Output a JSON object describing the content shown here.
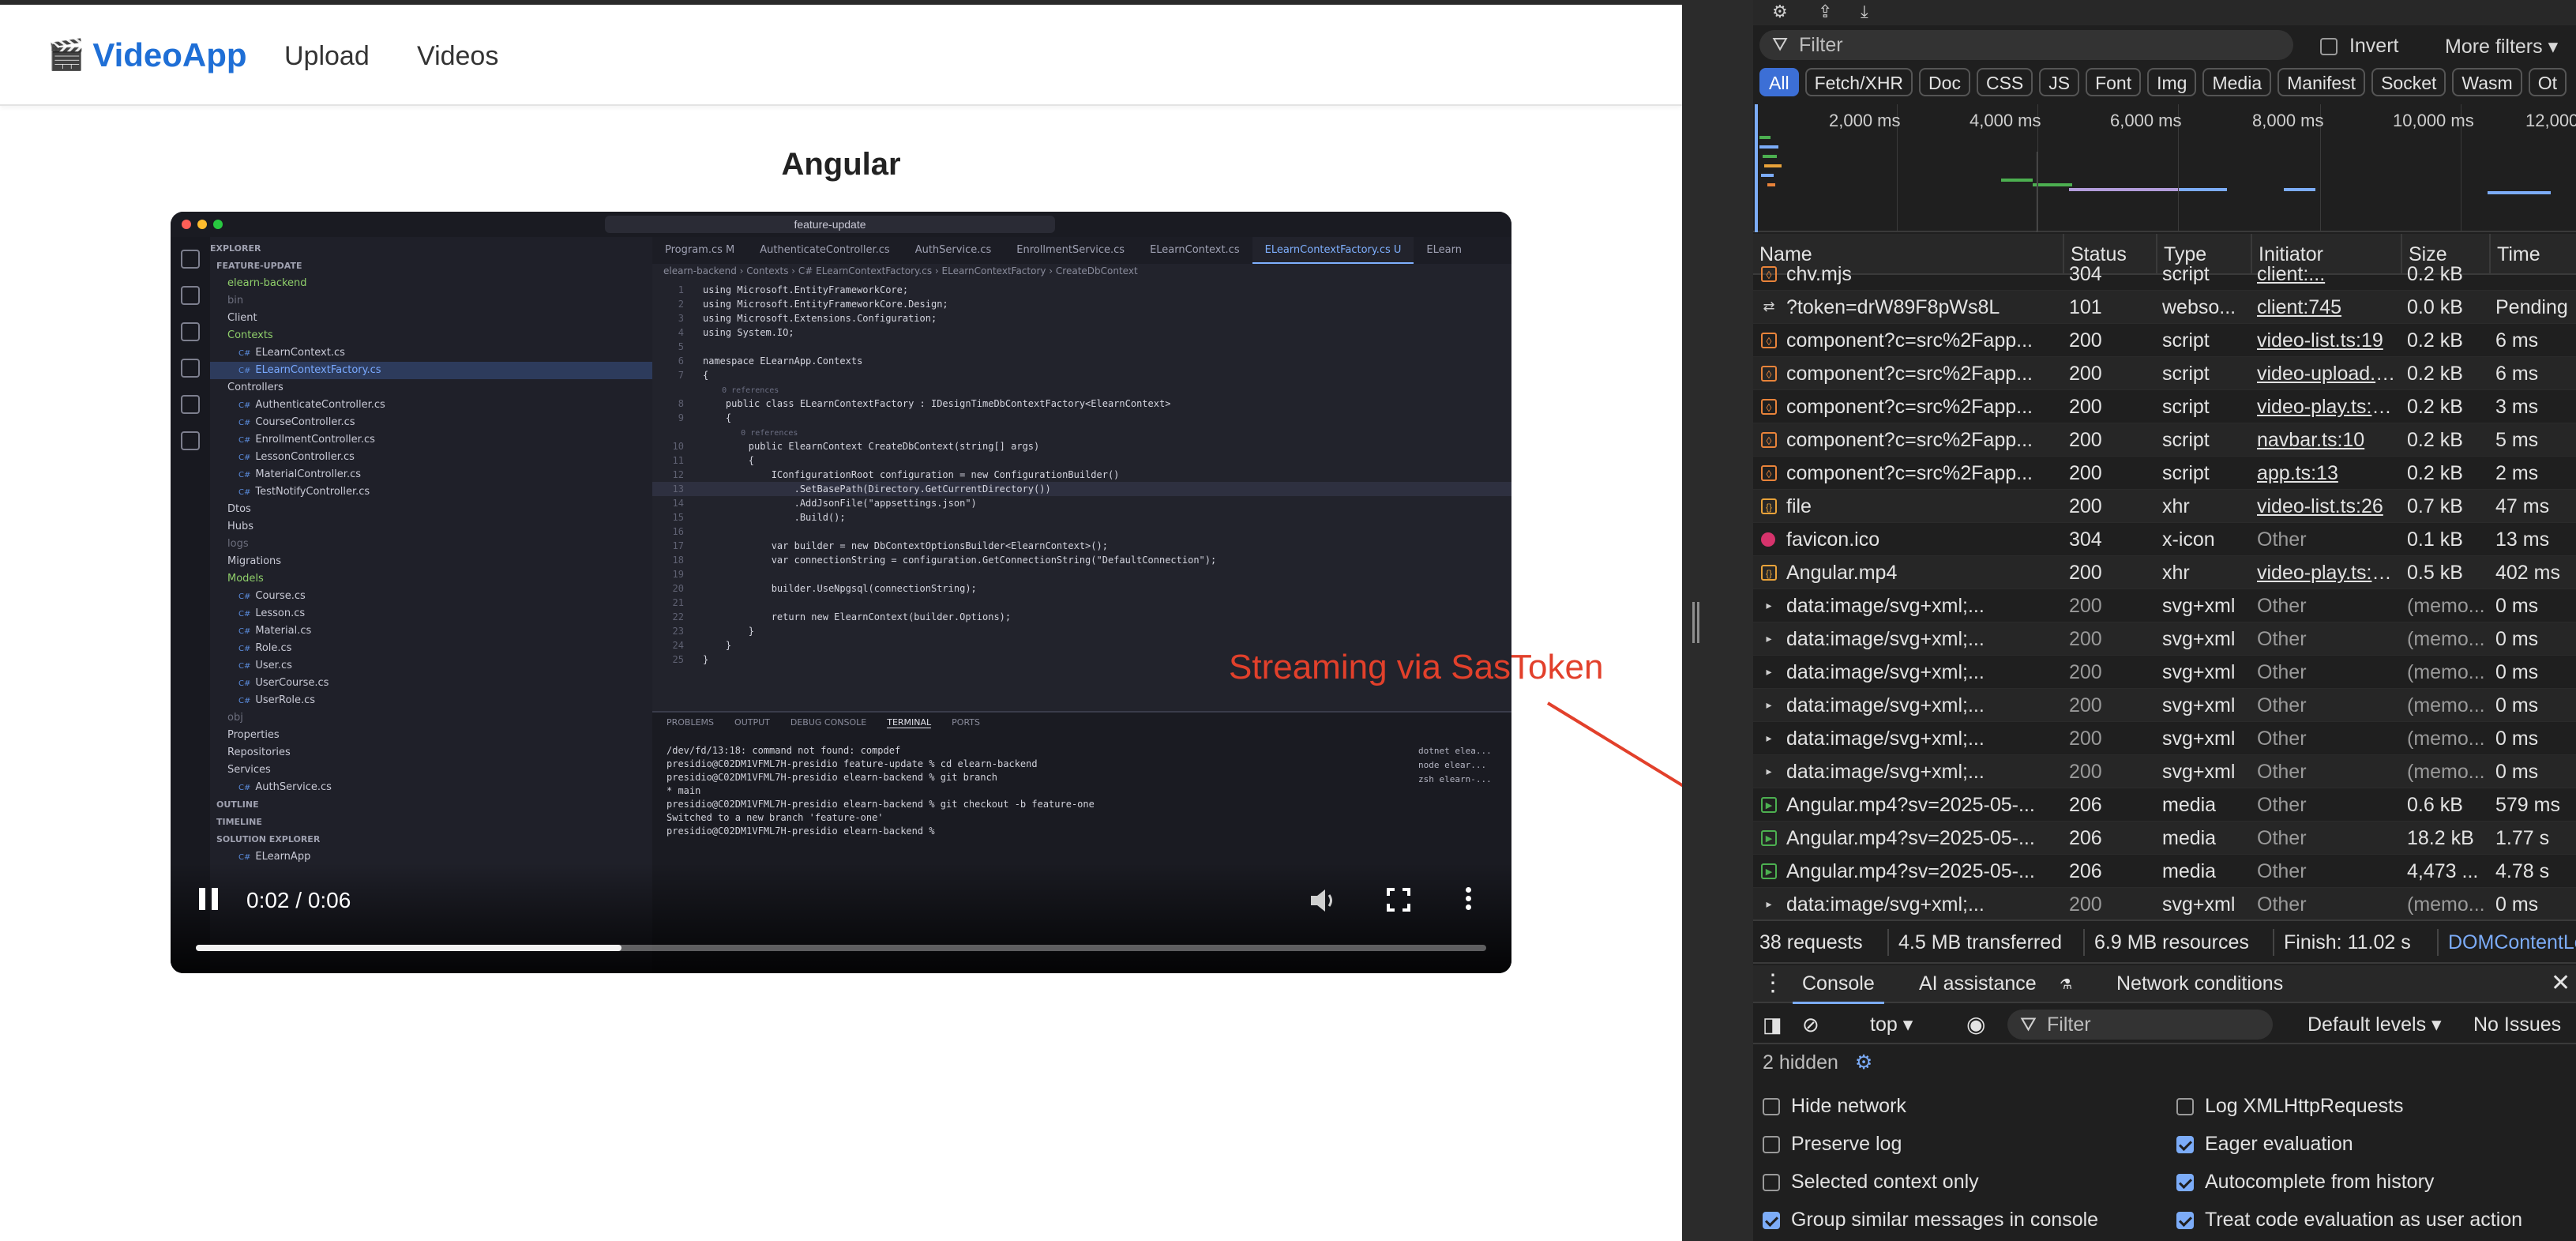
{
  "app": {
    "brand": "VideoApp",
    "brand_icon": "clapperboard-icon",
    "nav": [
      "Upload",
      "Videos"
    ],
    "page_title": "Angular"
  },
  "video_player": {
    "current_time": "0:02 / 0:06",
    "progress": 0.33,
    "frame": {
      "search": "feature-update",
      "explorer_header": "EXPLORER",
      "explorer": [
        {
          "t": "FEATURE-UPDATE",
          "c": "hdr"
        },
        {
          "t": "elearn-backend",
          "c": "green"
        },
        {
          "t": "bin",
          "c": "muted"
        },
        {
          "t": "Client",
          "c": ""
        },
        {
          "t": "Contexts",
          "c": "green"
        },
        {
          "t": "ELearnContext.cs",
          "c": "cs"
        },
        {
          "t": "ELearnContextFactory.cs",
          "c": "sel"
        },
        {
          "t": "Controllers",
          "c": ""
        },
        {
          "t": "AuthenticateController.cs",
          "c": "cs"
        },
        {
          "t": "CourseController.cs",
          "c": "cs"
        },
        {
          "t": "EnrollmentController.cs",
          "c": "cs"
        },
        {
          "t": "LessonController.cs",
          "c": "cs"
        },
        {
          "t": "MaterialController.cs",
          "c": "cs"
        },
        {
          "t": "TestNotifyController.cs",
          "c": "cs"
        },
        {
          "t": "Dtos",
          "c": ""
        },
        {
          "t": "Hubs",
          "c": ""
        },
        {
          "t": "logs",
          "c": "muted"
        },
        {
          "t": "Migrations",
          "c": ""
        },
        {
          "t": "Models",
          "c": "green"
        },
        {
          "t": "Course.cs",
          "c": "cs"
        },
        {
          "t": "Lesson.cs",
          "c": "cs"
        },
        {
          "t": "Material.cs",
          "c": "cs"
        },
        {
          "t": "Role.cs",
          "c": "cs"
        },
        {
          "t": "User.cs",
          "c": "cs"
        },
        {
          "t": "UserCourse.cs",
          "c": "cs"
        },
        {
          "t": "UserRole.cs",
          "c": "cs"
        },
        {
          "t": "obj",
          "c": "muted"
        },
        {
          "t": "Properties",
          "c": ""
        },
        {
          "t": "Repositories",
          "c": ""
        },
        {
          "t": "Services",
          "c": ""
        },
        {
          "t": "AuthService.cs",
          "c": "cs"
        },
        {
          "t": "OUTLINE",
          "c": "hdr"
        },
        {
          "t": "TIMELINE",
          "c": "hdr"
        },
        {
          "t": "SOLUTION EXPLORER",
          "c": "hdr"
        },
        {
          "t": "ELearnApp",
          "c": "cs"
        }
      ],
      "tabs": [
        "Program.cs M",
        "AuthenticateController.cs",
        "AuthService.cs",
        "EnrollmentService.cs",
        "ELearnContext.cs",
        "ELearnContextFactory.cs U",
        "ELearn"
      ],
      "active_tab": 5,
      "breadcrumb": "elearn-backend › Contexts › C# ELearnContextFactory.cs › ELearnContextFactory › CreateDbContext",
      "code": [
        {
          "n": "1",
          "t": "using Microsoft.EntityFrameworkCore;"
        },
        {
          "n": "2",
          "t": "using Microsoft.EntityFrameworkCore.Design;"
        },
        {
          "n": "3",
          "t": "using Microsoft.Extensions.Configuration;"
        },
        {
          "n": "4",
          "t": "using System.IO;"
        },
        {
          "n": "5",
          "t": ""
        },
        {
          "n": "6",
          "t": "namespace ELearnApp.Contexts"
        },
        {
          "n": "7",
          "t": "{"
        },
        {
          "n": "",
          "t": "    0 references"
        },
        {
          "n": "8",
          "t": "    public class ELearnContextFactory : IDesignTimeDbContextFactory<ElearnContext>"
        },
        {
          "n": "9",
          "t": "    {"
        },
        {
          "n": "",
          "t": "        0 references"
        },
        {
          "n": "10",
          "t": "        public ElearnContext CreateDbContext(string[] args)"
        },
        {
          "n": "11",
          "t": "        {"
        },
        {
          "n": "12",
          "t": "            IConfigurationRoot configuration = new ConfigurationBuilder()"
        },
        {
          "n": "13",
          "t": "                .SetBasePath(Directory.GetCurrentDirectory())"
        },
        {
          "n": "14",
          "t": "                .AddJsonFile(\"appsettings.json\")"
        },
        {
          "n": "15",
          "t": "                .Build();"
        },
        {
          "n": "16",
          "t": ""
        },
        {
          "n": "17",
          "t": "            var builder = new DbContextOptionsBuilder<ElearnContext>();"
        },
        {
          "n": "18",
          "t": "            var connectionString = configuration.GetConnectionString(\"DefaultConnection\");"
        },
        {
          "n": "19",
          "t": ""
        },
        {
          "n": "20",
          "t": "            builder.UseNpgsql(connectionString);"
        },
        {
          "n": "21",
          "t": ""
        },
        {
          "n": "22",
          "t": "            return new ElearnContext(builder.Options);"
        },
        {
          "n": "23",
          "t": "        }"
        },
        {
          "n": "24",
          "t": "    }"
        },
        {
          "n": "25",
          "t": "}"
        }
      ],
      "highlight_line": 13,
      "terminal_tabs": [
        "PROBLEMS",
        "OUTPUT",
        "DEBUG CONSOLE",
        "TERMINAL",
        "PORTS"
      ],
      "terminal_active": 3,
      "terminal": [
        "/dev/fd/13:18: command not found: compdef",
        "presidio@C02DM1VFML7H-presidio feature-update % cd elearn-backend",
        "presidio@C02DM1VFML7H-presidio elearn-backend % git branch",
        "* main",
        "presidio@C02DM1VFML7H-presidio elearn-backend % git checkout -b feature-one",
        "Switched to a new branch 'feature-one'",
        "presidio@C02DM1VFML7H-presidio elearn-backend % "
      ],
      "terminal_side": [
        "dotnet elea...",
        "node elear...",
        "zsh elearn-..."
      ]
    }
  },
  "annotation": {
    "text": "Streaming via SasToken",
    "color": "#e2402b"
  },
  "devtools": {
    "filter_placeholder": "Filter",
    "invert_label": "Invert",
    "more_filters": "More filters",
    "type_filters": [
      "All",
      "Fetch/XHR",
      "Doc",
      "CSS",
      "JS",
      "Font",
      "Img",
      "Media",
      "Manifest",
      "Socket",
      "Wasm",
      "Ot"
    ],
    "timeline_labels": [
      "2,000 ms",
      "4,000 ms",
      "6,000 ms",
      "8,000 ms",
      "10,000 ms",
      "12,000"
    ],
    "columns": [
      "Name",
      "Status",
      "Type",
      "Initiator",
      "Size",
      "Time"
    ],
    "rows": [
      {
        "icon": "script",
        "name": "chv.mjs",
        "status": "304",
        "type": "script",
        "initiator": "client:...",
        "size": "0.2 kB",
        "time": "",
        "ilink": true,
        "dim": false
      },
      {
        "icon": "ws",
        "name": "?token=drW89F8pWs8L",
        "status": "101",
        "type": "webso...",
        "initiator": "client:745",
        "size": "0.0 kB",
        "time": "Pending",
        "ilink": true,
        "dim": false
      },
      {
        "icon": "script",
        "name": "component?c=src%2Fapp...",
        "status": "200",
        "type": "script",
        "initiator": "video-list.ts:19",
        "size": "0.2 kB",
        "time": "6 ms",
        "ilink": true,
        "dim": false
      },
      {
        "icon": "script",
        "name": "component?c=src%2Fapp...",
        "status": "200",
        "type": "script",
        "initiator": "video-upload.ts:...",
        "size": "0.2 kB",
        "time": "6 ms",
        "ilink": true,
        "dim": false
      },
      {
        "icon": "script",
        "name": "component?c=src%2Fapp...",
        "status": "200",
        "type": "script",
        "initiator": "video-play.ts:12...",
        "size": "0.2 kB",
        "time": "3 ms",
        "ilink": true,
        "dim": false
      },
      {
        "icon": "script",
        "name": "component?c=src%2Fapp...",
        "status": "200",
        "type": "script",
        "initiator": "navbar.ts:10",
        "size": "0.2 kB",
        "time": "5 ms",
        "ilink": true,
        "dim": false
      },
      {
        "icon": "script",
        "name": "component?c=src%2Fapp...",
        "status": "200",
        "type": "script",
        "initiator": "app.ts:13",
        "size": "0.2 kB",
        "time": "2 ms",
        "ilink": true,
        "dim": false
      },
      {
        "icon": "xhr",
        "name": "file",
        "status": "200",
        "type": "xhr",
        "initiator": "video-list.ts:26",
        "size": "0.7 kB",
        "time": "47 ms",
        "ilink": true,
        "dim": false
      },
      {
        "icon": "ang",
        "name": "favicon.ico",
        "status": "304",
        "type": "x-icon",
        "initiator": "Other",
        "size": "0.1 kB",
        "time": "13 ms",
        "ilink": false,
        "dim": false
      },
      {
        "icon": "xhr",
        "name": "Angular.mp4",
        "status": "200",
        "type": "xhr",
        "initiator": "video-play.ts:22...",
        "size": "0.5 kB",
        "time": "402 ms",
        "ilink": true,
        "dim": false
      },
      {
        "icon": "svg",
        "name": "data:image/svg+xml;...",
        "status": "200",
        "type": "svg+xml",
        "initiator": "Other",
        "size": "(memo...",
        "time": "0 ms",
        "ilink": false,
        "dim": true
      },
      {
        "icon": "svg",
        "name": "data:image/svg+xml;...",
        "status": "200",
        "type": "svg+xml",
        "initiator": "Other",
        "size": "(memo...",
        "time": "0 ms",
        "ilink": false,
        "dim": true
      },
      {
        "icon": "svg",
        "name": "data:image/svg+xml;...",
        "status": "200",
        "type": "svg+xml",
        "initiator": "Other",
        "size": "(memo...",
        "time": "0 ms",
        "ilink": false,
        "dim": true
      },
      {
        "icon": "svg",
        "name": "data:image/svg+xml;...",
        "status": "200",
        "type": "svg+xml",
        "initiator": "Other",
        "size": "(memo...",
        "time": "0 ms",
        "ilink": false,
        "dim": true
      },
      {
        "icon": "svg",
        "name": "data:image/svg+xml;...",
        "status": "200",
        "type": "svg+xml",
        "initiator": "Other",
        "size": "(memo...",
        "time": "0 ms",
        "ilink": false,
        "dim": true
      },
      {
        "icon": "svg",
        "name": "data:image/svg+xml;...",
        "status": "200",
        "type": "svg+xml",
        "initiator": "Other",
        "size": "(memo...",
        "time": "0 ms",
        "ilink": false,
        "dim": true
      },
      {
        "icon": "media",
        "name": "Angular.mp4?sv=2025-05-...",
        "status": "206",
        "type": "media",
        "initiator": "Other",
        "size": "0.6 kB",
        "time": "579 ms",
        "ilink": false,
        "dim": false
      },
      {
        "icon": "media",
        "name": "Angular.mp4?sv=2025-05-...",
        "status": "206",
        "type": "media",
        "initiator": "Other",
        "size": "18.2 kB",
        "time": "1.77 s",
        "ilink": false,
        "dim": false
      },
      {
        "icon": "media",
        "name": "Angular.mp4?sv=2025-05-...",
        "status": "206",
        "type": "media",
        "initiator": "Other",
        "size": "4,473 ...",
        "time": "4.78 s",
        "ilink": false,
        "dim": false
      },
      {
        "icon": "svg",
        "name": "data:image/svg+xml;...",
        "status": "200",
        "type": "svg+xml",
        "initiator": "Other",
        "size": "(memo...",
        "time": "0 ms",
        "ilink": false,
        "dim": true
      }
    ],
    "status_bar": [
      "38 requests",
      "4.5 MB transferred",
      "6.9 MB resources",
      "Finish: 11.02 s",
      "DOMContentLo"
    ],
    "drawer_tabs": [
      "Console",
      "AI assistance",
      "Network conditions"
    ],
    "console_context": "top",
    "console_filter": "Filter",
    "default_levels": "Default levels",
    "no_issues": "No Issues",
    "hidden_count": "2 hidden",
    "settings": [
      {
        "label": "Hide network",
        "checked": false
      },
      {
        "label": "Log XMLHttpRequests",
        "checked": false
      },
      {
        "label": "Preserve log",
        "checked": false
      },
      {
        "label": "Eager evaluation",
        "checked": true
      },
      {
        "label": "Selected context only",
        "checked": false
      },
      {
        "label": "Autocomplete from history",
        "checked": true
      },
      {
        "label": "Group similar messages in console",
        "checked": true
      },
      {
        "label": "Treat code evaluation as user action",
        "checked": true
      }
    ],
    "colors": {
      "accent": "#7cacf8",
      "chip_active": "#3c6fd6",
      "brand": "#1f6fd6"
    }
  }
}
